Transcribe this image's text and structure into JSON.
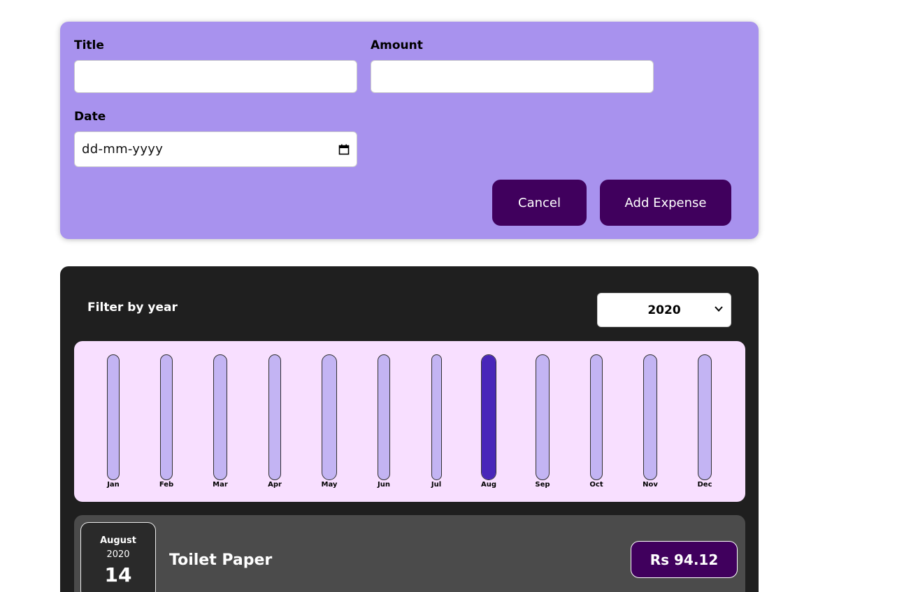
{
  "form": {
    "title_label": "Title",
    "title_value": "",
    "amount_label": "Amount",
    "amount_value": "",
    "date_label": "Date",
    "date_placeholder": "dd-mm-yyyy",
    "cancel_label": "Cancel",
    "submit_label": "Add Expense"
  },
  "filter": {
    "label": "Filter by year",
    "selected_year": "2020"
  },
  "chart_data": {
    "type": "bar",
    "categories": [
      "Jan",
      "Feb",
      "Mar",
      "Apr",
      "May",
      "Jun",
      "Jul",
      "Aug",
      "Sep",
      "Oct",
      "Nov",
      "Dec"
    ],
    "values": [
      0,
      0,
      0,
      0,
      0,
      0,
      0,
      94.12,
      0,
      0,
      0,
      0
    ],
    "fill_fraction": [
      0,
      0,
      0,
      0,
      0,
      0,
      0,
      1,
      0,
      0,
      0,
      0
    ],
    "title": "",
    "xlabel": "",
    "ylabel": ""
  },
  "expenses": [
    {
      "month": "August",
      "year": "2020",
      "day": "14",
      "title": "Toilet Paper",
      "amount": "Rs 94.12"
    }
  ],
  "colors": {
    "form_bg": "#a892ee",
    "button_bg": "#40005d",
    "panel_bg": "#1f1f1f",
    "chart_bg": "#f8dfff",
    "bar_empty": "#c3b4f3",
    "bar_fill": "#4826b9",
    "item_bg": "#4b4b4b"
  },
  "icons": {
    "date_picker": "calendar-icon",
    "year_dropdown": "chevron-down-icon"
  }
}
